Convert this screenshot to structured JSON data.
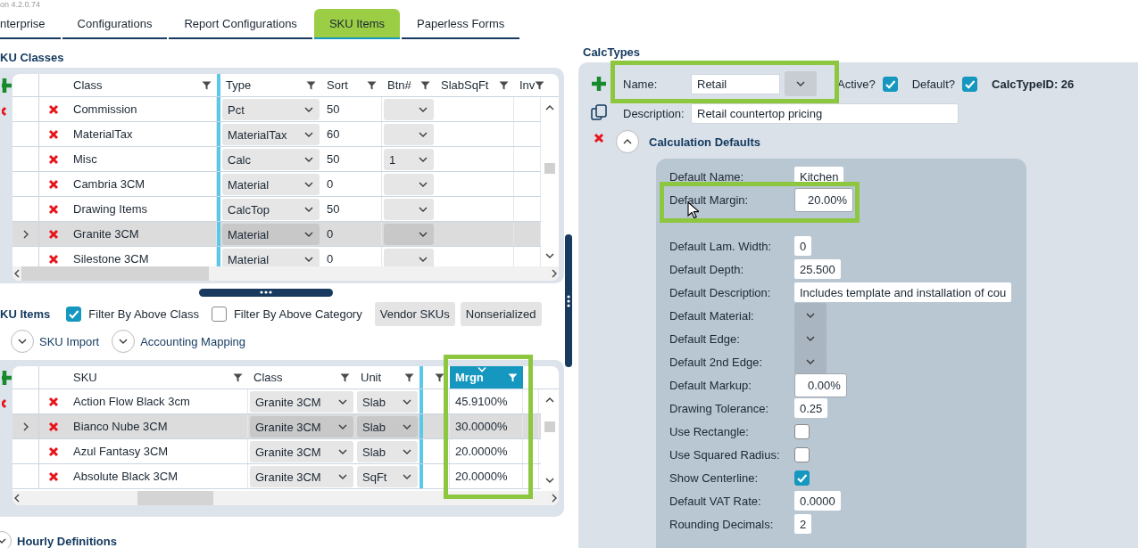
{
  "version": "on 4.2.0.74",
  "tabs": [
    {
      "label": "nterprise",
      "selected": false
    },
    {
      "label": "Configurations",
      "selected": false
    },
    {
      "label": "Report Configurations",
      "selected": false
    },
    {
      "label": "SKU Items",
      "selected": true
    },
    {
      "label": "Paperless Forms",
      "selected": false
    }
  ],
  "sku_classes": {
    "title": "KU Classes",
    "columns": [
      {
        "kind": "label",
        "label": "Class",
        "highlighted": false
      },
      {
        "kind": "label",
        "label": "Type",
        "highlighted": false
      },
      {
        "kind": "label",
        "label": "Sort",
        "highlighted": false
      },
      {
        "kind": "label",
        "label": "Btn#",
        "highlighted": false
      },
      {
        "kind": "label",
        "label": "SlabSqFt",
        "highlighted": false
      },
      {
        "kind": "label",
        "label": "Inv",
        "highlighted": false
      }
    ],
    "rows": [
      {
        "selected": false,
        "cells": [
          {
            "kind": "text",
            "value": "Commission"
          },
          {
            "kind": "select",
            "value": "Pct"
          },
          {
            "kind": "text",
            "value": "50"
          },
          {
            "kind": "select"
          }
        ]
      },
      {
        "selected": false,
        "cells": [
          {
            "kind": "text",
            "value": "MaterialTax"
          },
          {
            "kind": "select",
            "value": "MaterialTax"
          },
          {
            "kind": "text",
            "value": "60"
          },
          {
            "kind": "select"
          }
        ]
      },
      {
        "selected": false,
        "cells": [
          {
            "kind": "text",
            "value": "Misc"
          },
          {
            "kind": "select",
            "value": "Calc"
          },
          {
            "kind": "text",
            "value": "50"
          },
          {
            "kind": "select",
            "value": "1"
          }
        ]
      },
      {
        "selected": false,
        "cells": [
          {
            "kind": "text",
            "value": "Cambria 3CM"
          },
          {
            "kind": "select",
            "value": "Material"
          },
          {
            "kind": "text",
            "value": "0"
          },
          {
            "kind": "select"
          }
        ]
      },
      {
        "selected": false,
        "cells": [
          {
            "kind": "text",
            "value": "Drawing Items"
          },
          {
            "kind": "select",
            "value": "CalcTop"
          },
          {
            "kind": "text",
            "value": "50"
          },
          {
            "kind": "select"
          }
        ]
      },
      {
        "selected": true,
        "cells": [
          {
            "kind": "text",
            "value": "Granite 3CM"
          },
          {
            "kind": "select",
            "value": "Material"
          },
          {
            "kind": "text",
            "value": "0"
          },
          {
            "kind": "select"
          }
        ]
      },
      {
        "selected": false,
        "cells": [
          {
            "kind": "text",
            "value": "Silestone 3CM"
          },
          {
            "kind": "select",
            "value": "Material"
          },
          {
            "kind": "text",
            "value": "0"
          },
          {
            "kind": "select"
          }
        ]
      }
    ]
  },
  "sku_items": {
    "title": "KU Items",
    "filters": [
      {
        "label": "Filter By Above Class",
        "checked": true
      },
      {
        "label": "Filter By Above Category",
        "checked": false
      }
    ],
    "buttons": [
      "Vendor SKUs",
      "Nonserialized"
    ],
    "expanders": [
      {
        "label": "SKU Import",
        "expanded": false
      },
      {
        "label": "Accounting Mapping",
        "expanded": false
      }
    ],
    "columns": [
      {
        "kind": "label",
        "label": "SKU",
        "highlighted": false
      },
      {
        "kind": "label",
        "label": "Class",
        "highlighted": false
      },
      {
        "kind": "label",
        "label": "Unit",
        "highlighted": false
      },
      {
        "kind": "filter_only",
        "highlighted": false
      },
      {
        "kind": "label",
        "label": "Mrgn",
        "highlighted": true
      }
    ],
    "rows": [
      {
        "selected": false,
        "cells": [
          {
            "kind": "text",
            "value": "Action Flow Black 3cm"
          },
          {
            "kind": "select",
            "value": "Granite 3CM"
          },
          {
            "kind": "select",
            "value": "Slab"
          },
          {
            "kind": "text"
          },
          {
            "kind": "text",
            "value": "45.9100%"
          }
        ]
      },
      {
        "selected": true,
        "cells": [
          {
            "kind": "text",
            "value": "Bianco Nube 3CM"
          },
          {
            "kind": "select",
            "value": "Granite 3CM"
          },
          {
            "kind": "select",
            "value": "Slab"
          },
          {
            "kind": "text"
          },
          {
            "kind": "text",
            "value": "30.0000%"
          }
        ]
      },
      {
        "selected": false,
        "cells": [
          {
            "kind": "text",
            "value": "Azul Fantasy 3CM"
          },
          {
            "kind": "select",
            "value": "Granite 3CM"
          },
          {
            "kind": "select",
            "value": "Slab"
          },
          {
            "kind": "text"
          },
          {
            "kind": "text",
            "value": "20.0000%"
          }
        ]
      },
      {
        "selected": false,
        "cells": [
          {
            "kind": "text",
            "value": "Absolute Black 3CM"
          },
          {
            "kind": "select",
            "value": "Granite 3CM"
          },
          {
            "kind": "select",
            "value": "SqFt"
          },
          {
            "kind": "text"
          },
          {
            "kind": "text",
            "value": "20.0000%"
          }
        ]
      }
    ]
  },
  "hourly_definitions": {
    "label": "Hourly Definitions",
    "expanded": false
  },
  "calc_types": {
    "title": "CalcTypes",
    "name": {
      "label": "Name:",
      "value": "Retail"
    },
    "active": {
      "label": "Active?",
      "checked": true
    },
    "default": {
      "label": "Default?",
      "checked": true
    },
    "id_label": "CalcTypeID: 26",
    "description": {
      "label": "Description:",
      "value": "Retail countertop pricing"
    },
    "defaults": {
      "title": "Calculation Defaults",
      "expanded": true,
      "fields": [
        {
          "label": "Default Name:",
          "kind": "input",
          "value": "Kitchen"
        },
        {
          "label": "Default Margin:",
          "kind": "percent",
          "value": "20.00%"
        },
        {
          "label": "Default Lam. Width:",
          "kind": "input",
          "value": "0"
        },
        {
          "label": "Default Depth:",
          "kind": "input",
          "value": "25.500"
        },
        {
          "label": "Default Description:",
          "kind": "input",
          "value": "Includes template and installation of cou"
        },
        {
          "label": "Default Material:",
          "kind": "select"
        },
        {
          "label": "Default Edge:",
          "kind": "select"
        },
        {
          "label": "Default 2nd Edge:",
          "kind": "select"
        },
        {
          "label": "Default Markup:",
          "kind": "percent",
          "value": "0.00%"
        },
        {
          "label": "Drawing Tolerance:",
          "kind": "input",
          "value": "0.25"
        },
        {
          "label": "Use Rectangle:",
          "kind": "checkbox",
          "checked": false
        },
        {
          "label": "Use Squared Radius:",
          "kind": "checkbox",
          "checked": false
        },
        {
          "label": "Show Centerline:",
          "kind": "checkbox",
          "checked": true
        },
        {
          "label": "Default VAT Rate:",
          "kind": "input",
          "value": "0.0000"
        },
        {
          "label": "Rounding Decimals:",
          "kind": "input",
          "value": "2"
        }
      ]
    }
  }
}
